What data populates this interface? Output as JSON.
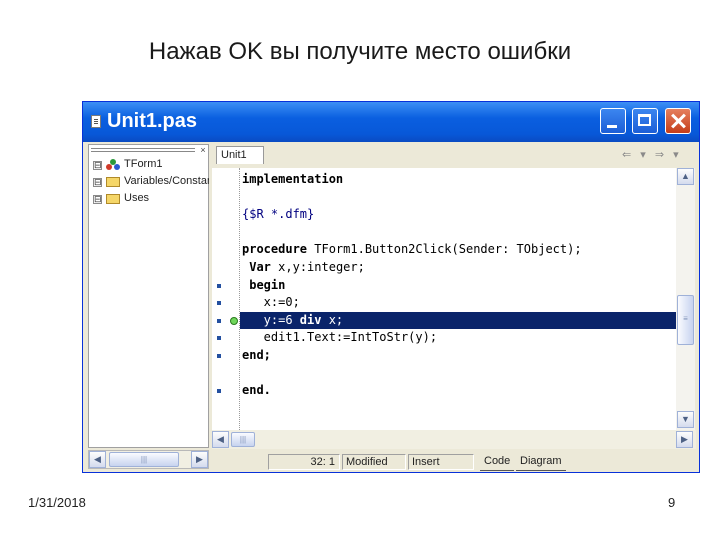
{
  "slide": {
    "title": "Нажав OK вы получите место ошибки",
    "date": "1/31/2018",
    "page_number": "9"
  },
  "window": {
    "title": "Unit1.pas",
    "icons": {
      "title": "document-icon",
      "minimize": "minimize-icon",
      "maximize": "maximize-icon",
      "close": "close-icon"
    }
  },
  "tree": {
    "close_glyph": "×",
    "items": [
      {
        "label": "TForm1",
        "expander": "⊟",
        "icon": "form-icon"
      },
      {
        "label": "Variables/Constants",
        "expander": "⊟",
        "icon": "folder-icon"
      },
      {
        "label": "Uses",
        "expander": "⊟",
        "icon": "folder-icon"
      }
    ]
  },
  "scroll": {
    "left_arrow": "◀",
    "right_arrow": "▶",
    "up_arrow": "▲",
    "down_arrow": "▼",
    "grip": "|||",
    "grip_v": "≡"
  },
  "editor": {
    "tab_label": "Unit1",
    "nav_arrows": "⇐ ▾ ⇒ ▾",
    "code_lines": [
      {
        "text": "implementation",
        "style": "kw"
      },
      {
        "text": "",
        "style": ""
      },
      {
        "text": "{$R *.dfm}",
        "style": "comment"
      },
      {
        "text": "",
        "style": ""
      },
      {
        "text": "procedure TForm1.Button2Click(Sender: TObject);",
        "style": "mixed-proc"
      },
      {
        "text": " Var x,y:integer;",
        "style": "mixed-var"
      },
      {
        "text": " begin",
        "style": "kw"
      },
      {
        "text": "   x:=0;",
        "style": ""
      },
      {
        "text": "   y:=6 div x;",
        "style": "hl"
      },
      {
        "text": "   edit1.Text:=IntToStr(y);",
        "style": ""
      },
      {
        "text": "end;",
        "style": "kw"
      },
      {
        "text": "",
        "style": ""
      },
      {
        "text": "end.",
        "style": "kw"
      }
    ],
    "breakpoint_rows": [
      6,
      7,
      8,
      9,
      10,
      12
    ],
    "execution_row": 8
  },
  "status": {
    "position": "32: 1",
    "modified": "Modified",
    "insert": "Insert",
    "tab_code": "Code",
    "tab_diagram": "Diagram"
  }
}
